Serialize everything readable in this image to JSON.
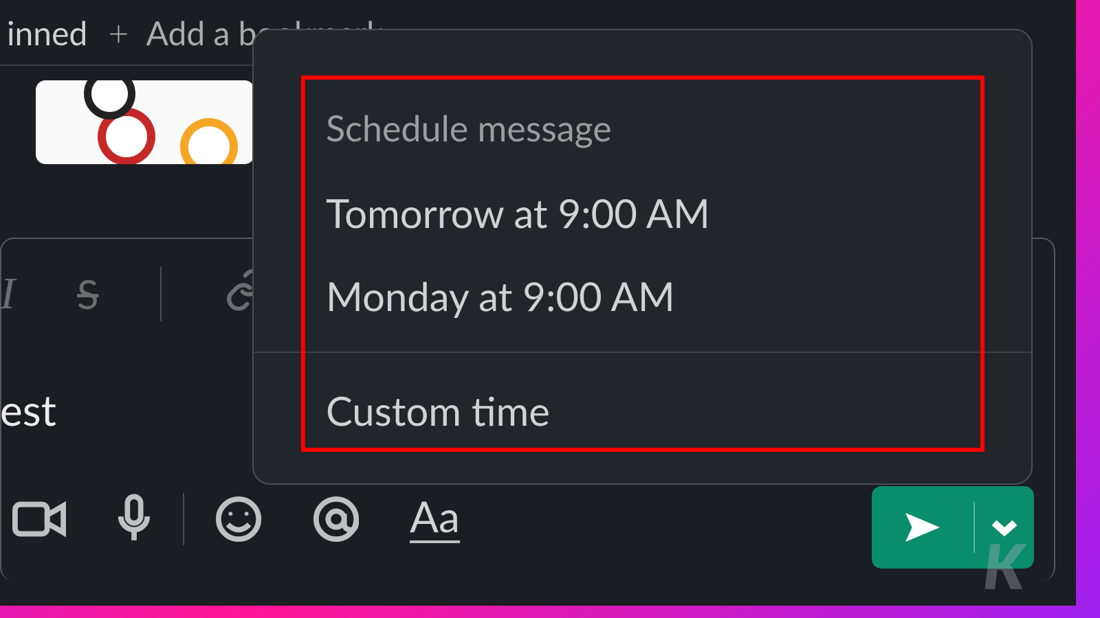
{
  "toolbar": {
    "pinned_text": "inned",
    "add_bookmark_label": "Add a bookmark",
    "plus_glyph": "+"
  },
  "schedule_popup": {
    "title": "Schedule message",
    "options": [
      "Tomorrow at 9:00 AM",
      "Monday at 9:00 AM"
    ],
    "custom_label": "Custom time"
  },
  "partial_text": {
    "est": "est"
  },
  "formatting_icons": {
    "italic": "I",
    "strike": "S",
    "aa": "Aa"
  },
  "watermark": "K",
  "colors": {
    "highlight": "#ff0000",
    "send_button": "#0a8d6b",
    "background": "#1a1d21"
  }
}
